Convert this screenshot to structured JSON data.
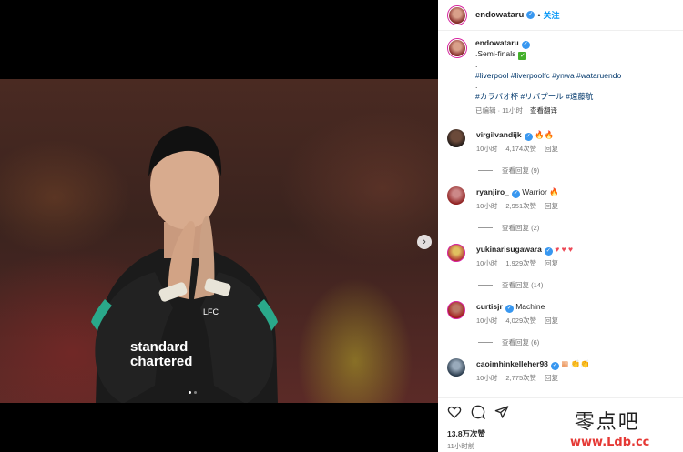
{
  "post": {
    "username": "endowataru",
    "follow_label": "关注",
    "caption": {
      "title_line": ".Semi-finals",
      "dot_line": ".",
      "hashtags_en": "#liverpool #liverpoolfc #ynwa #wataruendo",
      "dot_line2": ".",
      "hashtags_jp": "#カラバオ杯 #リバプール #遠藤航",
      "edited": "已编辑 · 11小时",
      "translate": "查看翻译"
    }
  },
  "comments": [
    {
      "user": "virgilvandijk",
      "text": "",
      "emoji": [
        "fire",
        "fire"
      ],
      "time": "10小时",
      "likes": "4,174次赞",
      "reply": "回复",
      "view_replies": "查看回复 (9)"
    },
    {
      "user": "ryanjiro_",
      "text": "Warrior",
      "emoji": [
        "fire"
      ],
      "time": "10小时",
      "likes": "2,951次赞",
      "reply": "回复",
      "view_replies": "查看回复 (2)"
    },
    {
      "user": "yukinarisugawara",
      "text": "",
      "emoji": [
        "heart",
        "heart",
        "heart"
      ],
      "time": "10小时",
      "likes": "1,929次赞",
      "reply": "回复",
      "view_replies": "查看回复 (14)"
    },
    {
      "user": "curtisjr",
      "text": "Machine",
      "emoji": [],
      "time": "10小时",
      "likes": "4,029次赞",
      "reply": "回复",
      "view_replies": "查看回复 (6)"
    },
    {
      "user": "caoimhinkelleher98",
      "text": "",
      "emoji": [
        "flag",
        "clap",
        "clap"
      ],
      "time": "10小时",
      "likes": "2,775次赞",
      "reply": "回复",
      "view_replies": ""
    }
  ],
  "footer": {
    "likes": "13.8万次赞",
    "time_ago": "11小时前"
  },
  "photo": {
    "sponsor_line1": "standard",
    "sponsor_line2": "chartered",
    "crest": "LFC"
  },
  "watermark": {
    "line1": "零点吧",
    "line2": "www.Ldb.cc"
  },
  "colors": {
    "accent": "#0095f6",
    "verified": "#3897f0",
    "hashtag": "#00376b",
    "heart": "#ed4956"
  },
  "icons": [
    "verified-icon",
    "heart-icon",
    "comment-icon",
    "share-icon",
    "chevron-right-icon",
    "checkmark-icon",
    "fire-icon"
  ]
}
